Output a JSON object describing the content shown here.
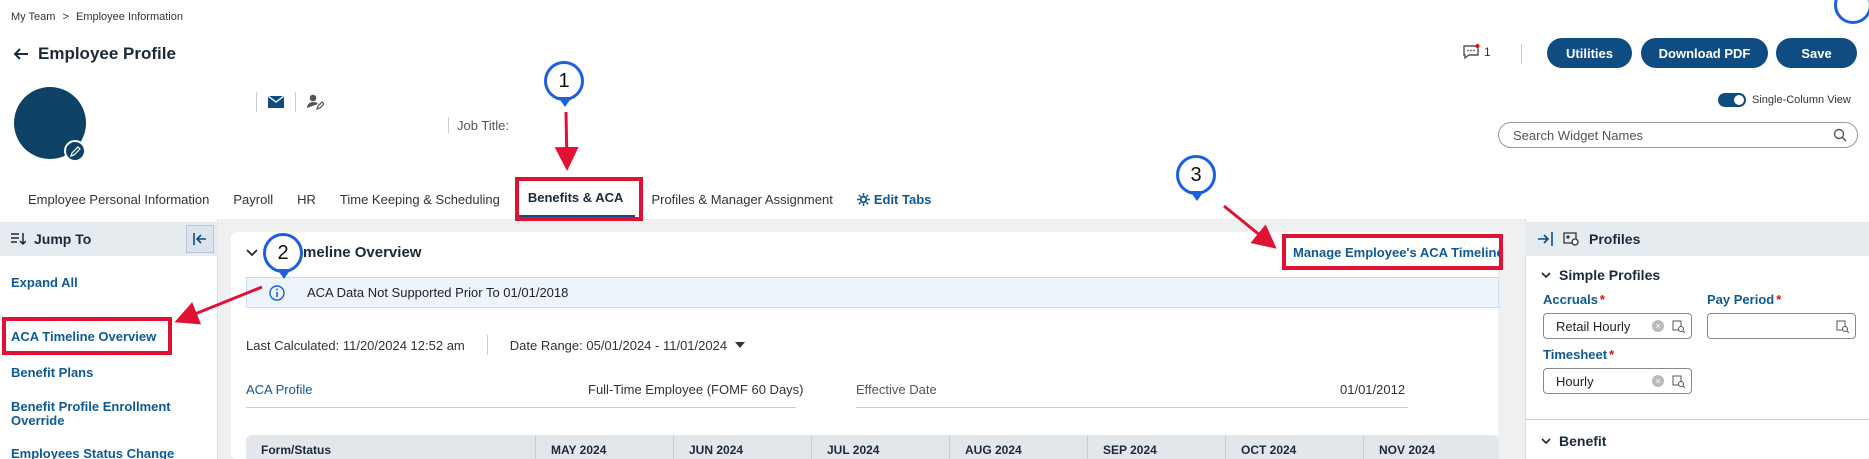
{
  "breadcrumb": {
    "root": "My Team",
    "separator": ">",
    "current": "Employee Information"
  },
  "page": {
    "title": "Employee Profile"
  },
  "header": {
    "notification_count": "1",
    "buttons": {
      "utilities": "Utilities",
      "download_pdf": "Download PDF",
      "save": "Save"
    }
  },
  "profile": {
    "job_title_label": "Job Title:"
  },
  "view_toggle": {
    "label": "Single-Column View",
    "on": true
  },
  "widget_search": {
    "placeholder": "Search Widget Names"
  },
  "tabs": [
    {
      "label": "Employee Personal Information"
    },
    {
      "label": "Payroll"
    },
    {
      "label": "HR"
    },
    {
      "label": "Time Keeping & Scheduling"
    },
    {
      "label": "Benefits & ACA",
      "active": true
    },
    {
      "label": "Profiles & Manager Assignment"
    },
    {
      "label": "Edit Tabs"
    }
  ],
  "callouts": {
    "one": "1",
    "two": "2",
    "three": "3"
  },
  "jump_to": {
    "title": "Jump To",
    "links": {
      "expand_all": "Expand All",
      "aca_timeline": "ACA Timeline Overview",
      "benefit_plans": "Benefit Plans",
      "enrollment_override": "Benefit Profile Enrollment Override",
      "status_change": "Employees Status Change"
    }
  },
  "timeline": {
    "title": "Timeline Overview",
    "manage_link": "Manage Employee's ACA Timeline",
    "info_message": "ACA Data Not Supported Prior To 01/01/2018",
    "last_calculated": "Last Calculated: 11/20/2024 12:52 am",
    "date_range": "Date Range: 05/01/2024 - 11/01/2024",
    "aca_profile_label": "ACA Profile",
    "aca_profile_value": "Full-Time Employee (FOMF 60 Days)",
    "effective_date_label": "Effective Date",
    "effective_date_value": "01/01/2012",
    "table_headers": [
      "Form/Status",
      "MAY 2024",
      "JUN 2024",
      "JUL 2024",
      "AUG 2024",
      "SEP 2024",
      "OCT 2024",
      "NOV 2024"
    ]
  },
  "profiles_panel": {
    "title": "Profiles",
    "simple_profiles": "Simple Profiles",
    "accruals_label": "Accruals",
    "accruals_value": "Retail Hourly",
    "pay_period_label": "Pay Period",
    "pay_period_value": "",
    "timesheet_label": "Timesheet",
    "timesheet_value": "Hourly",
    "benefit_section": "Benefit",
    "required_mark": "*"
  },
  "colors": {
    "primary": "#0f4c81",
    "link": "#0f5a96",
    "highlight": "#e01133",
    "callout": "#1c5fe0"
  }
}
